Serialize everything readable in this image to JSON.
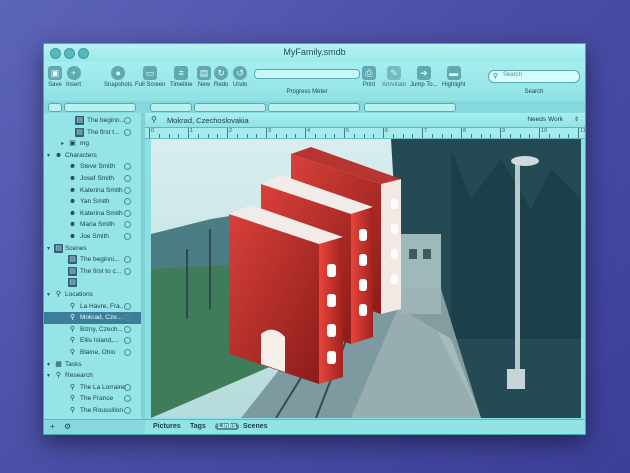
{
  "window": {
    "title": "MyFamily.smdb"
  },
  "toolbar": {
    "save": "Save",
    "insert": "Insert",
    "snapshots": "Snapshots",
    "fullscreen": "Full Screen",
    "timeline": "Timeline",
    "new": "New",
    "redo": "Redo",
    "undo": "Undo",
    "meter_label": "Progress Meter",
    "print": "Print",
    "annotate": "Annotate",
    "jump": "Jump To...",
    "highlight": "Highlight",
    "search_placeholder": "Search",
    "search_label": "Search"
  },
  "binder": {
    "items": [
      {
        "label": "The beginn...",
        "indent": 3,
        "icon": "doc"
      },
      {
        "label": "The first t...",
        "indent": 3,
        "icon": "doc"
      },
      {
        "label": "mg",
        "indent": 2,
        "icon": "clip"
      },
      {
        "label": "Characters",
        "indent": 0,
        "icon": "person"
      },
      {
        "label": "Steve Smith",
        "indent": 2,
        "icon": "person"
      },
      {
        "label": "Josef Smith",
        "indent": 2,
        "icon": "person"
      },
      {
        "label": "Katerina Smith",
        "indent": 2,
        "icon": "person"
      },
      {
        "label": "Yan Smith",
        "indent": 2,
        "icon": "person"
      },
      {
        "label": "Katerina Smith",
        "indent": 2,
        "icon": "person"
      },
      {
        "label": "Maria Smith",
        "indent": 2,
        "icon": "person"
      },
      {
        "label": "Joe Smith",
        "indent": 2,
        "icon": "person"
      },
      {
        "label": "Scenes",
        "indent": 0,
        "icon": "doc"
      },
      {
        "label": "The beginni...",
        "indent": 2,
        "icon": "doc"
      },
      {
        "label": "The first to c...",
        "indent": 2,
        "icon": "doc"
      },
      {
        "label": "",
        "indent": 2,
        "icon": "doc"
      },
      {
        "label": "Locations",
        "indent": 0,
        "icon": "pin"
      },
      {
        "label": "La Havre, Fra...",
        "indent": 2,
        "icon": "pin"
      },
      {
        "label": "Mokrad, Cze...",
        "indent": 2,
        "icon": "pin",
        "selected": true
      },
      {
        "label": "Bizny, Czech...",
        "indent": 2,
        "icon": "pin"
      },
      {
        "label": "Ellis Island,...",
        "indent": 2,
        "icon": "pin"
      },
      {
        "label": "Blaine, Ohio",
        "indent": 2,
        "icon": "pin"
      },
      {
        "label": "Tasks",
        "indent": 0,
        "icon": "box"
      },
      {
        "label": "Research",
        "indent": 0,
        "icon": "search"
      },
      {
        "label": "The La Lorraine",
        "indent": 2,
        "icon": "search"
      },
      {
        "label": "The France",
        "indent": 2,
        "icon": "search"
      },
      {
        "label": "The Roussillon",
        "indent": 2,
        "icon": "search"
      }
    ]
  },
  "editor": {
    "title": "Mokrad, Czechoslovakia",
    "status": "Needs Work",
    "ruler": [
      "0",
      "1",
      "2",
      "3",
      "4",
      "5",
      "6",
      "7",
      "8",
      "9",
      "10",
      "11"
    ]
  },
  "tabs": [
    "Pictures",
    "Tags",
    "Links",
    "Scenes"
  ],
  "colors": {
    "accent": "#3d7d9c",
    "book_red": "#c9302c"
  }
}
